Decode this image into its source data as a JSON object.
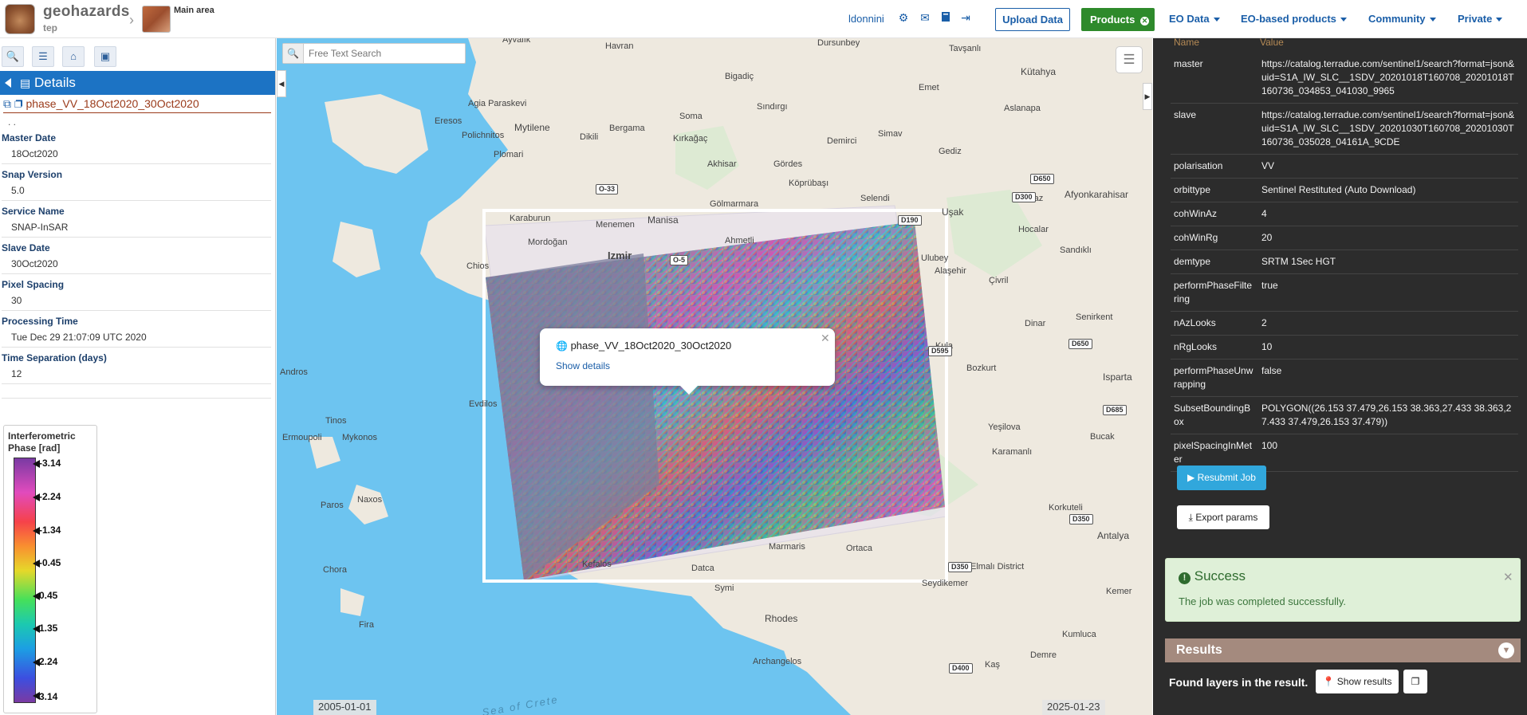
{
  "header": {
    "brand": "geohazards",
    "brand_sub": "tep",
    "area_label": "Main area",
    "username": "ldonnini",
    "upload_label": "Upload Data",
    "products_label": "Products",
    "nav": [
      "EO Data",
      "EO-based products",
      "Community",
      "Private"
    ],
    "icons": [
      "gear-icon",
      "envelope-icon",
      "book-icon",
      "sign-out-icon"
    ]
  },
  "left_panel": {
    "toolbar_icons": [
      "search-icon",
      "list-icon",
      "basket-icon",
      "archive-icon"
    ],
    "details_title": "Details",
    "product_title": "phase_VV_18Oct2020_30Oct2020",
    "properties": [
      {
        "key": "Master Date",
        "value": "18Oct2020"
      },
      {
        "key": "Snap Version",
        "value": "5.0"
      },
      {
        "key": "Service Name",
        "value": "SNAP-InSAR"
      },
      {
        "key": "Slave Date",
        "value": "30Oct2020"
      },
      {
        "key": "Pixel Spacing",
        "value": "30"
      },
      {
        "key": "Processing Time",
        "value": "Tue Dec 29 21:07:09 UTC 2020"
      },
      {
        "key": "Time Separation (days)",
        "value": "12"
      }
    ],
    "legend": {
      "title": "Interferometric Phase [rad]",
      "ticks": [
        "-3.14",
        "-2.24",
        "-1.34",
        "-0.45",
        "0.45",
        "1.35",
        "2.24",
        "3.14"
      ]
    }
  },
  "map": {
    "search_placeholder": "Free Text Search",
    "popup": {
      "title": "phase_VV_18Oct2020_30Oct2020",
      "link": "Show details"
    },
    "date_start": "2005-01-01",
    "date_end": "2025-01-23",
    "places": [
      "Ayvalık",
      "Havran",
      "Dursunbey",
      "Tavşanlı",
      "Kütahya",
      "Bigadiç",
      "Agia Paraskevi",
      "Eresos",
      "Mytilene",
      "Soma",
      "Sındırgı",
      "Simav",
      "Emet",
      "Bergama",
      "Dikili",
      "Polichnitos",
      "Plomari",
      "Kırkağaç",
      "Demirci",
      "Gediz",
      "Aslanapa",
      "Akhisar",
      "Gördes",
      "Köprübaşı",
      "Karaburun",
      "Manisa",
      "Selendi",
      "Uşak",
      "Banaz",
      "Afyonkarahisar",
      "Menemen",
      "Gölmarmara",
      "Mordoğan",
      "Ahmetli",
      "Hocalar",
      "Izmir",
      "Chios",
      "Ulubey",
      "Çivril",
      "Sandıklı",
      "Andros",
      "Dinar",
      "Senirkent",
      "Evdilos",
      "Isparta",
      "Bozkurt",
      "Tinos",
      "Ermoupoli",
      "Mykonos",
      "Yeşilova",
      "Bucak",
      "Karamanlı",
      "Paros",
      "Naxos",
      "Korkuteli",
      "Chora",
      "Marmaris",
      "Ortaca",
      "Kefalos",
      "Datca",
      "Symi",
      "Elmalı District",
      "Seydikemer",
      "Kemer",
      "Fira",
      "Rhodes",
      "Archangelos",
      "Demre",
      "Kumluca",
      "Kaş",
      "Antalya",
      "Sea of Crete",
      "Alaşehir",
      "Kula",
      "Isparta"
    ],
    "roads": [
      "O-33",
      "D650",
      "D300",
      "D190",
      "O-5",
      "D595",
      "D650",
      "D685",
      "D350",
      "D350",
      "D400"
    ]
  },
  "right_panel": {
    "header_key": "Name",
    "header_value": "Value",
    "params": [
      {
        "key": "master",
        "value": "https://catalog.terradue.com/sentinel1/search?format=json&uid=S1A_IW_SLC__1SDV_20201018T160708_20201018T160736_034853_041030_9965"
      },
      {
        "key": "slave",
        "value": "https://catalog.terradue.com/sentinel1/search?format=json&uid=S1A_IW_SLC__1SDV_20201030T160708_20201030T160736_035028_04161A_9CDE"
      },
      {
        "key": "polarisation",
        "value": "VV"
      },
      {
        "key": "orbittype",
        "value": "Sentinel Restituted (Auto Download)"
      },
      {
        "key": "cohWinAz",
        "value": "4"
      },
      {
        "key": "cohWinRg",
        "value": "20"
      },
      {
        "key": "demtype",
        "value": "SRTM 1Sec HGT"
      },
      {
        "key": "performPhaseFiltering",
        "value": "true"
      },
      {
        "key": "nAzLooks",
        "value": "2"
      },
      {
        "key": "nRgLooks",
        "value": "10"
      },
      {
        "key": "performPhaseUnwrapping",
        "value": "false"
      },
      {
        "key": "SubsetBoundingBox",
        "value": "POLYGON((26.153 37.479,26.153 38.363,27.433 38.363,27.433 37.479,26.153 37.479))"
      },
      {
        "key": "pixelSpacingInMeter",
        "value": "100"
      }
    ],
    "resubmit_label": "Resubmit Job",
    "export_label": "Export params",
    "success_title": "Success",
    "success_msg": "The job was completed successfully.",
    "results_title": "Results",
    "found_label": "Found layers in the result.",
    "show_results_label": "Show results"
  }
}
